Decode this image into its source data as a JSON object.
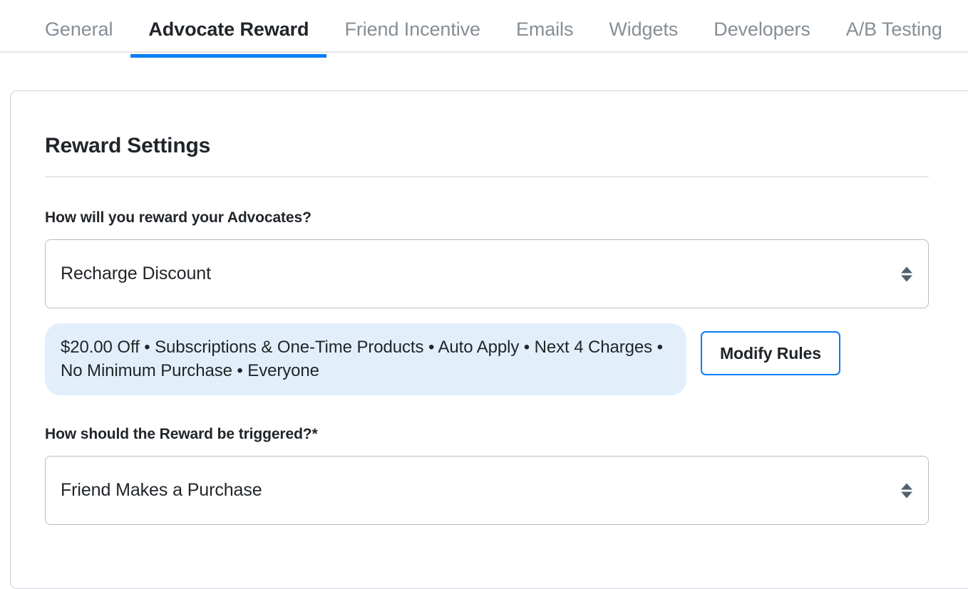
{
  "tabs": [
    {
      "label": "General",
      "active": false
    },
    {
      "label": "Advocate Reward",
      "active": true
    },
    {
      "label": "Friend Incentive",
      "active": false
    },
    {
      "label": "Emails",
      "active": false
    },
    {
      "label": "Widgets",
      "active": false
    },
    {
      "label": "Developers",
      "active": false
    },
    {
      "label": "A/B Testing",
      "active": false
    }
  ],
  "card": {
    "title": "Reward Settings",
    "reward_type": {
      "label": "How will you reward your Advocates?",
      "selected": "Recharge Discount",
      "dropdown_icon": "chevron-updown-icon"
    },
    "summary": {
      "text": "$20.00 Off • Subscriptions & One-Time Products • Auto Apply • Next 4 Charges • No Minimum Purchase • Everyone",
      "button_label": "Modify Rules"
    },
    "trigger": {
      "label": "How should the Reward be triggered?*",
      "selected": "Friend Makes a Purchase",
      "dropdown_icon": "chevron-updown-icon"
    }
  },
  "colors": {
    "accent_blue": "#067df7",
    "pill_background": "#e2effb",
    "inactive_tab_text": "#868e96",
    "text_primary": "#212529",
    "border": "#b9bcc0"
  }
}
